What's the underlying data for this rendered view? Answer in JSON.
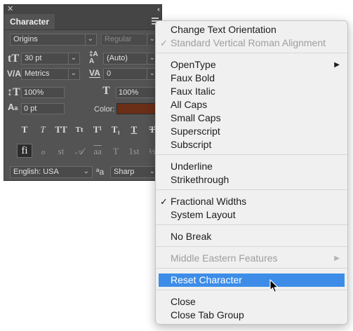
{
  "panel": {
    "close_glyph": "✕",
    "collapse_glyph": "‹‹",
    "tab_label": "Character",
    "font_family": "Origins",
    "font_style": "Regular",
    "font_size": "30 pt",
    "leading": "(Auto)",
    "kerning": "Metrics",
    "tracking": "0",
    "vertical_scale": "100%",
    "horizontal_scale": "100%",
    "baseline_shift": "0 pt",
    "color_label": "Color:",
    "color_value": "#6b2e16",
    "style_buttons": [
      "T",
      "T",
      "TT",
      "Tt",
      "T¹",
      "T₁",
      "T",
      "T"
    ],
    "opentype_buttons": [
      "fi",
      "ℴ",
      "st",
      "𝒜",
      "aa",
      "T",
      "1st",
      "½"
    ],
    "language": "English: USA",
    "aa_label": "ªa",
    "antialias": "Sharp"
  },
  "menu": {
    "items": [
      {
        "label": "Change Text Orientation",
        "disabled": false,
        "checked": false
      },
      {
        "label": "Standard Vertical Roman Alignment",
        "disabled": true,
        "checked": true
      },
      {
        "label": "OpenType",
        "submenu": true
      },
      {
        "label": "Faux Bold"
      },
      {
        "label": "Faux Italic"
      },
      {
        "label": "All Caps"
      },
      {
        "label": "Small Caps"
      },
      {
        "label": "Superscript"
      },
      {
        "label": "Subscript"
      },
      {
        "label": "Underline"
      },
      {
        "label": "Strikethrough"
      },
      {
        "label": "Fractional Widths",
        "checked": true
      },
      {
        "label": "System Layout"
      },
      {
        "label": "No Break"
      },
      {
        "label": "Middle Eastern Features",
        "disabled": true,
        "submenu": true
      },
      {
        "label": "Reset Character",
        "highlighted": true
      },
      {
        "label": "Close"
      },
      {
        "label": "Close Tab Group"
      }
    ],
    "check_glyph": "✓",
    "submenu_glyph": "▶"
  },
  "colors": {
    "panel_bg": "#535353",
    "menu_bg": "#f0f0f0",
    "highlight": "#3d8de8"
  }
}
